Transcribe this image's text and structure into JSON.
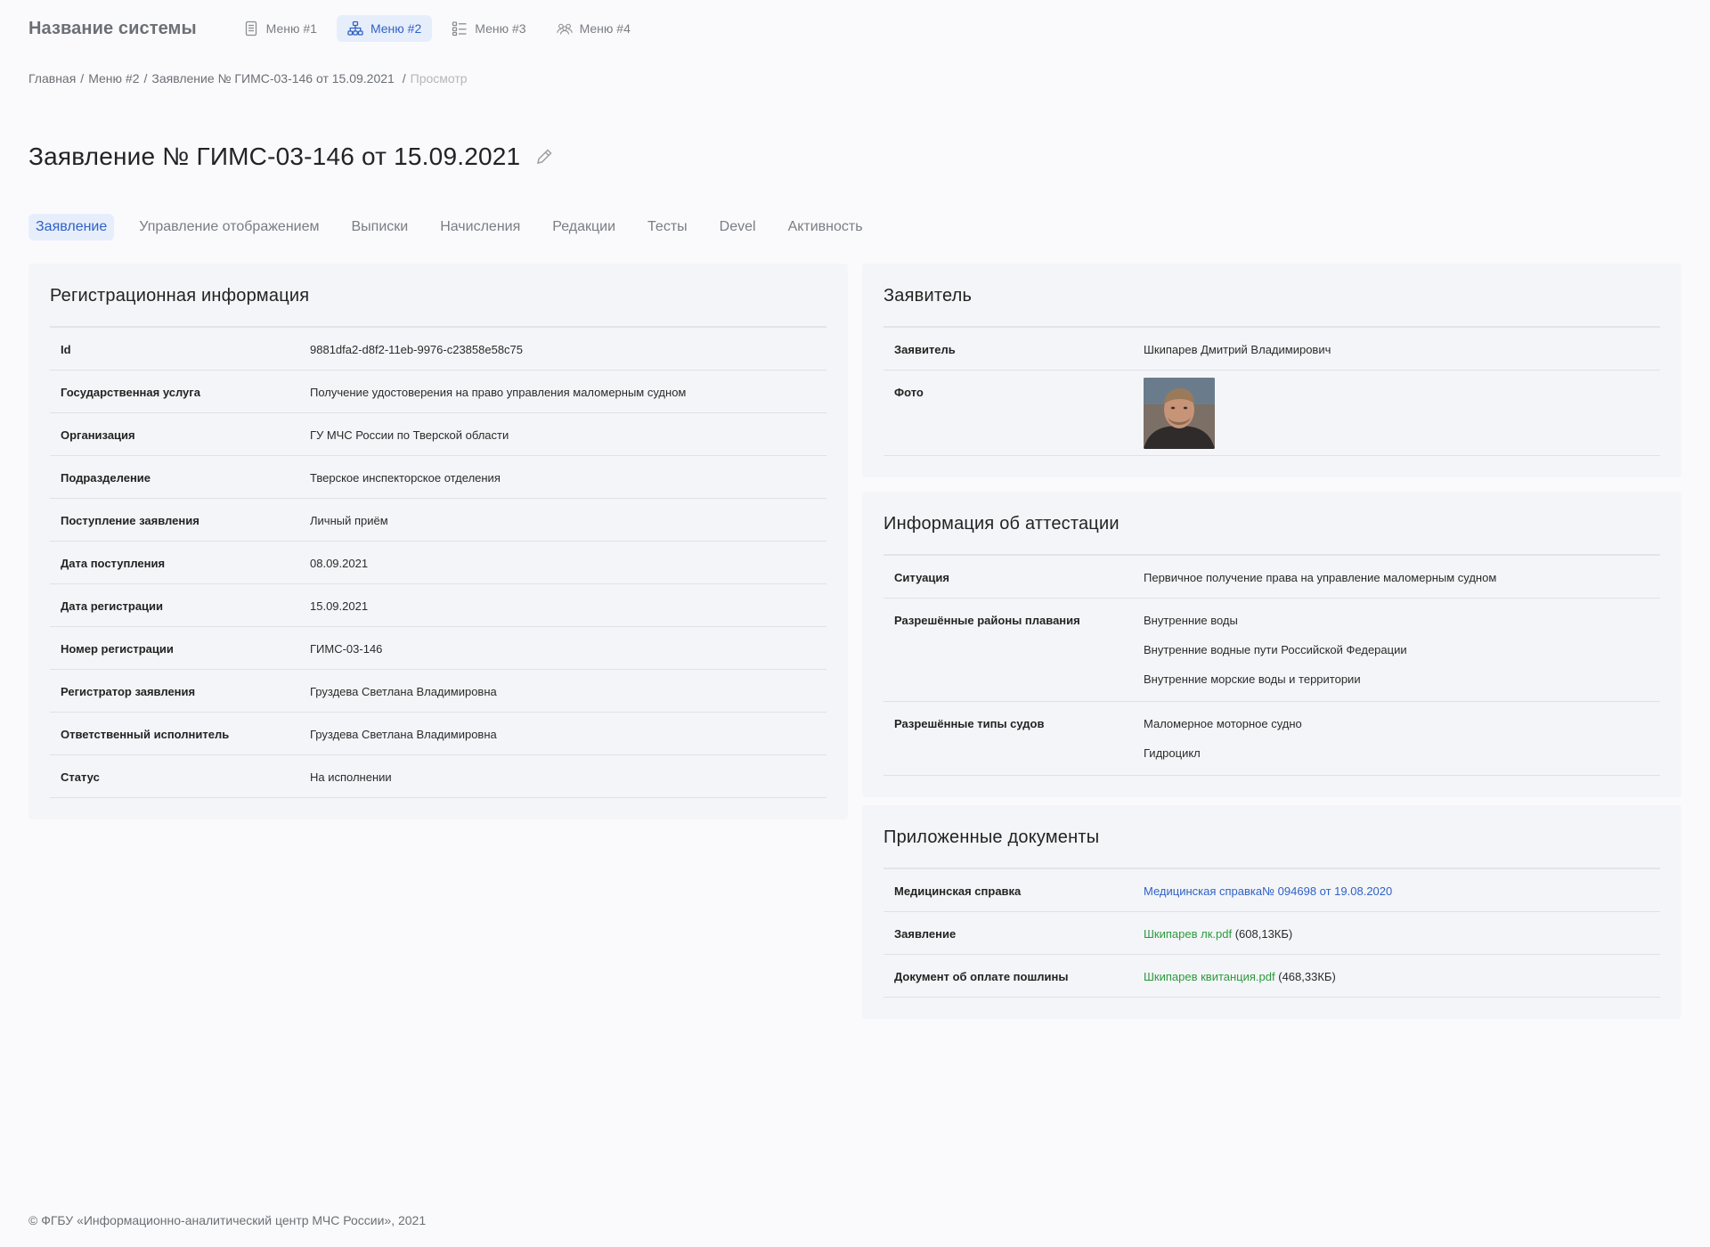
{
  "app": {
    "title": "Название системы"
  },
  "nav": {
    "items": [
      {
        "label": "Меню #1",
        "icon": "document-icon",
        "active": false
      },
      {
        "label": "Меню #2",
        "icon": "hierarchy-icon",
        "active": true
      },
      {
        "label": "Меню #3",
        "icon": "list-icon",
        "active": false
      },
      {
        "label": "Меню #4",
        "icon": "users-icon",
        "active": false
      }
    ]
  },
  "breadcrumb": {
    "items": [
      "Главная",
      "Меню #2",
      "Заявление № ГИМС-03-146 от 15.09.2021"
    ],
    "current": "Просмотр"
  },
  "page": {
    "title": "Заявление № ГИМС-03-146 от 15.09.2021"
  },
  "tabs": [
    {
      "label": "Заявление",
      "active": true
    },
    {
      "label": "Управление отображением",
      "active": false
    },
    {
      "label": "Выписки",
      "active": false
    },
    {
      "label": "Начисления",
      "active": false
    },
    {
      "label": "Редакции",
      "active": false
    },
    {
      "label": "Тесты",
      "active": false
    },
    {
      "label": "Devel",
      "active": false
    },
    {
      "label": "Активность",
      "active": false
    }
  ],
  "registration": {
    "title": "Регистрационная информация",
    "rows": [
      {
        "key": "Id",
        "value": "9881dfa2-d8f2-11eb-9976-c23858e58c75"
      },
      {
        "key": "Государственная услуга",
        "value": "Получение удостоверения на право управления маломерным судном"
      },
      {
        "key": "Организация",
        "value": "ГУ МЧС России по Тверской области"
      },
      {
        "key": "Подразделение",
        "value": "Тверское инспекторское отделения"
      },
      {
        "key": "Поступление заявления",
        "value": "Личный приём"
      },
      {
        "key": "Дата поступления",
        "value": "08.09.2021"
      },
      {
        "key": "Дата регистрации",
        "value": "15.09.2021"
      },
      {
        "key": "Номер регистрации",
        "value": "ГИМС-03-146"
      },
      {
        "key": "Регистратор заявления",
        "value": "Груздева Светлана Владимировна"
      },
      {
        "key": "Ответственный исполнитель",
        "value": "Груздева Светлана Владимировна"
      },
      {
        "key": "Статус",
        "value": "На исполнении"
      }
    ]
  },
  "applicant": {
    "title": "Заявитель",
    "name_key": "Заявитель",
    "name_value": "Шкипарев Дмитрий Владимирович",
    "photo_key": "Фото"
  },
  "attestation": {
    "title": "Информация об аттестации",
    "situation_key": "Ситуация",
    "situation_value": "Первичное получение права на управление маломерным судном",
    "areas_key": "Разрешённые районы плавания",
    "areas": [
      "Внутренние воды",
      "Внутренние водные пути Российской Федерации",
      "Внутренние морские воды и территории"
    ],
    "types_key": "Разрешённые типы судов",
    "types": [
      "Маломерное моторное судно",
      "Гидроцикл"
    ]
  },
  "documents": {
    "title": "Приложенные документы",
    "medical_key": "Медицинская справка",
    "medical_link": "Медицинская справка№ 094698 от 19.08.2020",
    "application_key": "Заявление",
    "application_file": "Шкипарев лк.pdf",
    "application_size": "(608,13КБ)",
    "payment_key": "Документ об оплате пошлины",
    "payment_file": "Шкипарев квитанция.pdf",
    "payment_size": "(468,33КБ)"
  },
  "footer": {
    "text": "© ФГБУ «Информационно-аналитический центр МЧС России», 2021"
  },
  "colors": {
    "accent": "#2f62c6",
    "accent_bg": "#e7eefb",
    "file_link": "#2c9a3e",
    "card_bg": "#f4f5f8"
  }
}
